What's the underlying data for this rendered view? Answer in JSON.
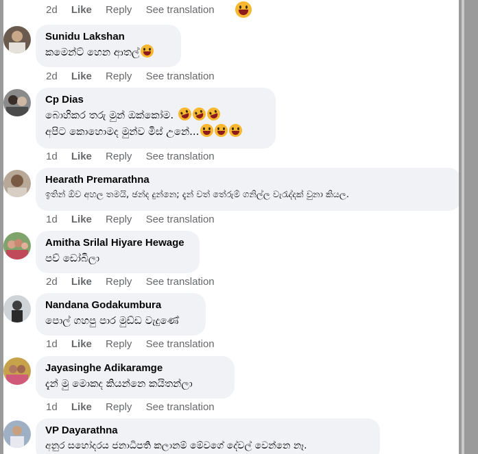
{
  "top_actions": {
    "time": "2d",
    "like": "Like",
    "reply": "Reply",
    "see": "See translation"
  },
  "comments": [
    {
      "author": "Sunidu Lakshan",
      "lines": [
        "කමෙන්ට් හෙන ආතල්"
      ],
      "time": "2d",
      "like": "Like",
      "reply": "Reply",
      "see": "See translation"
    },
    {
      "author": "Cp Dias",
      "lines": [
        "බොහිකර තරු මුන් ඔක්කෝම.",
        "අපිට කොහොමද මුන්ව මිස් උනේ..."
      ],
      "time": "1d",
      "like": "Like",
      "reply": "Reply",
      "see": "See translation"
    },
    {
      "author": "Hearath Premarathna",
      "lines": [
        "ඉතින් ඕව අහල තමයි, ඡන්ද දුන්නෙ; දැන් වත් තේරුම් ගනිල්ල වැරැද්දක් වුනා කියල."
      ],
      "time": "1d",
      "like": "Like",
      "reply": "Reply",
      "see": "See translation"
    },
    {
      "author": "Amitha Srilal Hiyare Hewage",
      "lines": [
        "පව් ඩෝබිලා"
      ],
      "time": "2d",
      "like": "Like",
      "reply": "Reply",
      "see": "See translation"
    },
    {
      "author": "Nandana Godakumbura",
      "lines": [
        "පොල් ගහපු පාර මුඩ්ඩ වැදුණේ"
      ],
      "time": "1d",
      "like": "Like",
      "reply": "Reply",
      "see": "See translation"
    },
    {
      "author": "Jayasinghe Adikaramge",
      "lines": [
        "දැන් මු මොකද කියන්නෙ කයිතන්ලා"
      ],
      "time": "1d",
      "like": "Like",
      "reply": "Reply",
      "see": "See translation"
    },
    {
      "author": "VP Dayarathna",
      "lines": [
        "අනුර සහෝදරය ජනාධිපති කලානම් මේවගේ දේවල් වෙන්නෙ නෑ."
      ]
    }
  ],
  "colors": {
    "bubble": "#f0f2f5",
    "meta": "#65676b",
    "text": "#050505"
  }
}
